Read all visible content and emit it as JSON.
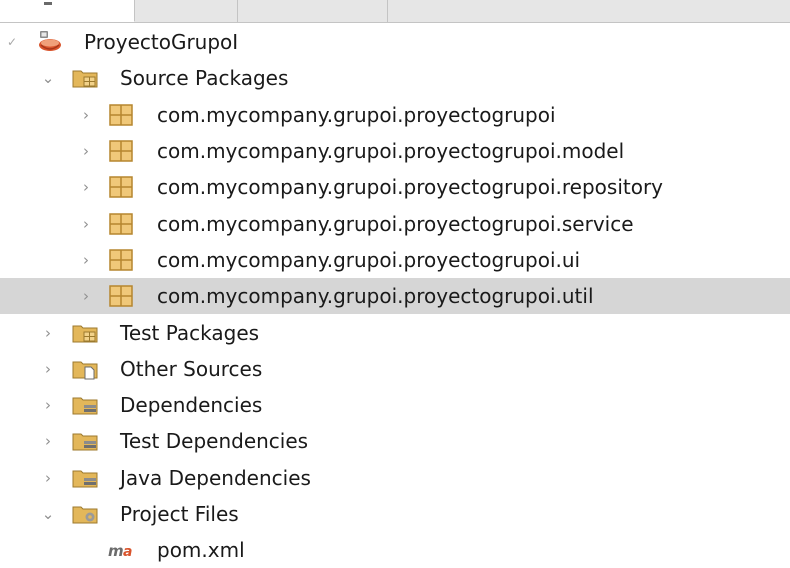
{
  "tree": {
    "project": {
      "label": "ProyectoGrupoI",
      "icon": "maven-project-icon"
    },
    "source_packages": {
      "label": "Source Packages",
      "packages": [
        "com.mycompany.grupoi.proyectogrupoi",
        "com.mycompany.grupoi.proyectogrupoi.model",
        "com.mycompany.grupoi.proyectogrupoi.repository",
        "com.mycompany.grupoi.proyectogrupoi.service",
        "com.mycompany.grupoi.proyectogrupoi.ui",
        "com.mycompany.grupoi.proyectogrupoi.util"
      ]
    },
    "test_packages": {
      "label": "Test Packages"
    },
    "other_sources": {
      "label": "Other Sources"
    },
    "dependencies": {
      "label": "Dependencies"
    },
    "test_dependencies": {
      "label": "Test Dependencies"
    },
    "java_dependencies": {
      "label": "Java Dependencies"
    },
    "project_files": {
      "label": "Project Files",
      "files": [
        "pom.xml"
      ]
    }
  },
  "colors": {
    "selection": "#d6d6d6",
    "folder": "#e3b75a",
    "package": "#d9a441",
    "project": "#d9542c"
  }
}
